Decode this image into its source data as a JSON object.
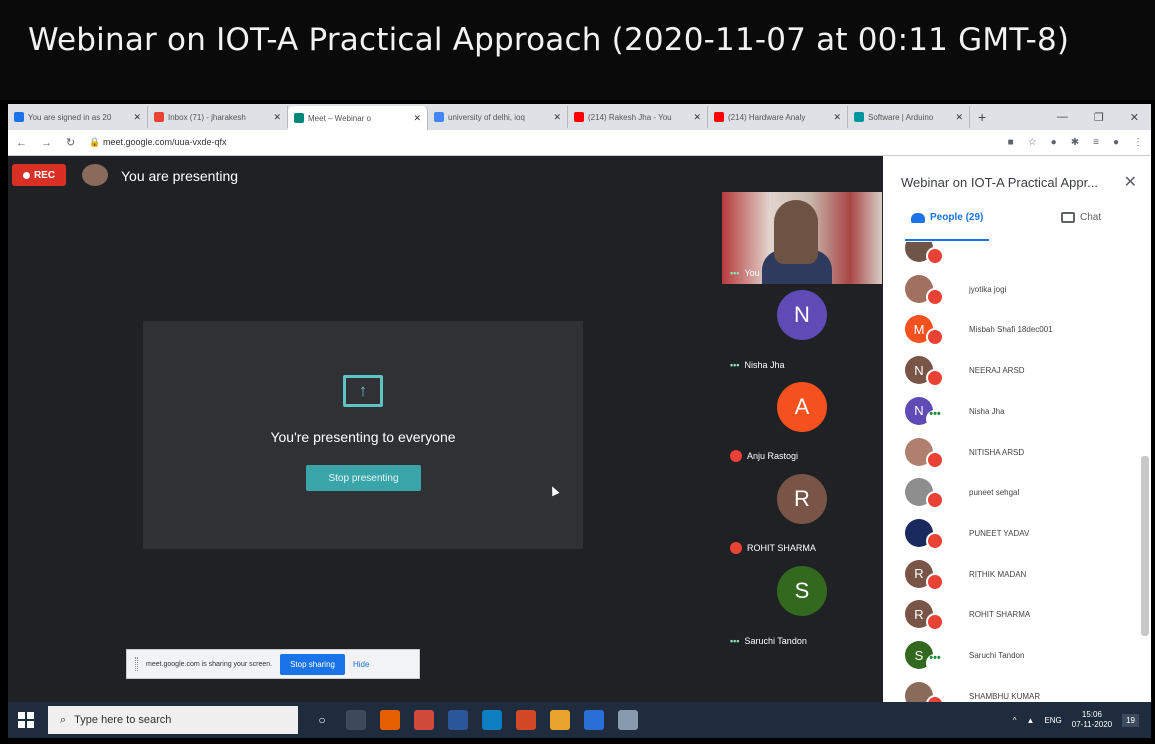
{
  "video_title": "Webinar on IOT-A Practical Approach (2020-11-07 at 00:11 GMT-8)",
  "browser": {
    "tabs": [
      {
        "label": "You are signed in as 20",
        "favicon_color": "#1a73e8",
        "active": false
      },
      {
        "label": "Inbox (71) - jharakesh",
        "favicon_color": "#ea4335",
        "active": false
      },
      {
        "label": "Meet – Webinar o",
        "favicon_color": "#00897b",
        "active": true
      },
      {
        "label": "university of delhi, ioq",
        "favicon_color": "#4285f4",
        "active": false
      },
      {
        "label": "(214) Rakesh Jha - You",
        "favicon_color": "#ff0000",
        "active": false
      },
      {
        "label": "(214) Hardware Analy",
        "favicon_color": "#ff0000",
        "active": false
      },
      {
        "label": "Software | Arduino",
        "favicon_color": "#00979c",
        "active": false
      }
    ],
    "new_tab": "+",
    "url": "meet.google.com/uua-vxde-qfx"
  },
  "meet": {
    "rec_label": "REC",
    "presenting_label": "You are presenting",
    "present_message": "You're presenting to everyone",
    "stop_presenting": "Stop presenting",
    "tiles": [
      {
        "name": "You",
        "type": "video",
        "status": "dots"
      },
      {
        "name": "Nisha Jha",
        "initial": "N",
        "color": "#5f4bb6",
        "status": "dots"
      },
      {
        "name": "Anju Rastogi",
        "initial": "A",
        "color": "#f4511e",
        "status": "muted"
      },
      {
        "name": "ROHIT SHARMA",
        "initial": "R",
        "color": "#795548",
        "status": "muted"
      },
      {
        "name": "Saruchi Tandon",
        "initial": "S",
        "color": "#33691e",
        "status": "dots"
      }
    ],
    "sharebar": {
      "text": "meet.google.com is sharing your screen.",
      "stop": "Stop sharing",
      "hide": "Hide"
    }
  },
  "panel": {
    "title": "Webinar on IOT-A Practical Appr...",
    "people_tab": "People (29)",
    "chat_tab": "Chat",
    "people": [
      {
        "name": "",
        "initial": "",
        "color": "#6d5548",
        "status": "muted"
      },
      {
        "name": "jyotika jogi",
        "initial": "",
        "color": "#a07060",
        "status": "muted"
      },
      {
        "name": "Misbah Shafi 18dec001",
        "initial": "M",
        "color": "#f4511e",
        "status": "muted"
      },
      {
        "name": "NEERAJ ARSD",
        "initial": "N",
        "color": "#795548",
        "status": "muted"
      },
      {
        "name": "Nisha Jha",
        "initial": "N",
        "color": "#5f4bb6",
        "status": "dots"
      },
      {
        "name": "NITISHA ARSD",
        "initial": "",
        "color": "#b0806e",
        "status": "muted"
      },
      {
        "name": "puneet sehgal",
        "initial": "",
        "color": "#8e8e8e",
        "status": "muted"
      },
      {
        "name": "PUNEET YADAV",
        "initial": "",
        "color": "#1a2a5e",
        "status": "muted"
      },
      {
        "name": "RITHIK MADAN",
        "initial": "R",
        "color": "#795548",
        "status": "muted"
      },
      {
        "name": "ROHIT SHARMA",
        "initial": "R",
        "color": "#795548",
        "status": "muted"
      },
      {
        "name": "Saruchi Tandon",
        "initial": "S",
        "color": "#33691e",
        "status": "dots"
      },
      {
        "name": "SHAMBHU KUMAR",
        "initial": "",
        "color": "#8a6a5a",
        "status": "muted"
      }
    ]
  },
  "taskbar": {
    "search_placeholder": "Type here to search",
    "lang": "ENG",
    "time": "15:06",
    "date": "07-11-2020",
    "notif_count": "19"
  }
}
